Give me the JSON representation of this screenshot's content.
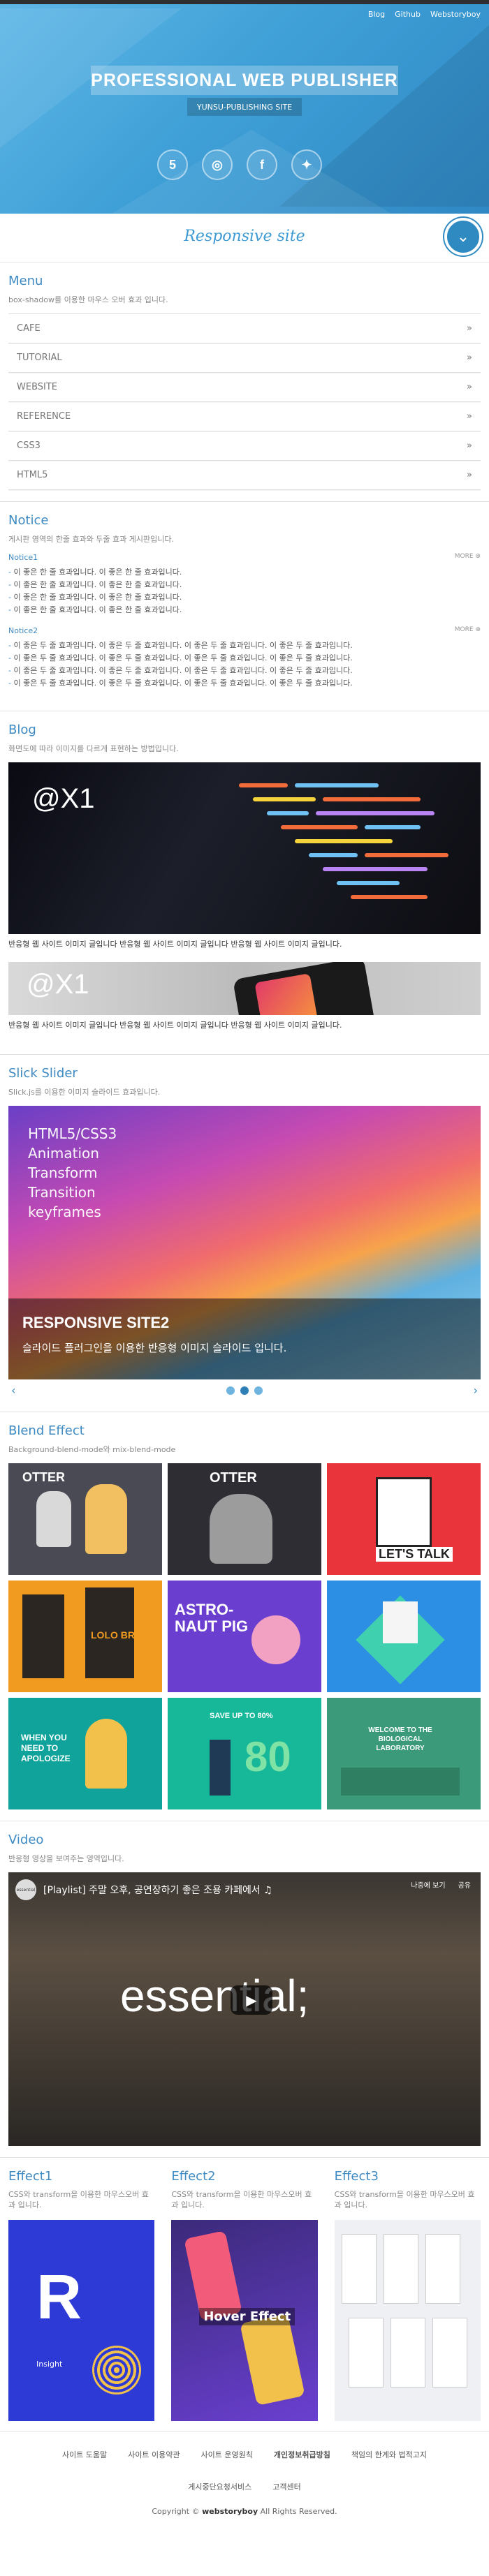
{
  "header": {
    "links": [
      "Blog",
      "Github",
      "Webstoryboy"
    ],
    "title": "PROFESSIONAL WEB PUBLISHER",
    "subtitle": "YUNSU-PUBLISHING SITE",
    "social": [
      {
        "icon": "html5-icon",
        "glyph": "5"
      },
      {
        "icon": "github-icon",
        "glyph": "◎"
      },
      {
        "icon": "facebook-icon",
        "glyph": "f"
      },
      {
        "icon": "twitter-icon",
        "glyph": "✦"
      }
    ]
  },
  "ribbon": {
    "tagline": "Responsive site",
    "down_glyph": "⌄"
  },
  "menu": {
    "title": "Menu",
    "desc": "box-shadow를 이용한 마우스 오버 효과 입니다.",
    "items": [
      "CAFE",
      "TUTORIAL",
      "WEBSITE",
      "REFERENCE",
      "CSS3",
      "HTML5"
    ],
    "chevron": "»"
  },
  "notice": {
    "title": "Notice",
    "desc": "게시판 영역의 한줄 효과와 두줄 효과 게시판입니다.",
    "groups": [
      {
        "label": "Notice1",
        "more": "MORE ⊕",
        "items": [
          "이 좋은 한 줄 효과입니다. 이 좋은 한 줄 효과입니다.",
          "이 좋은 한 줄 효과입니다. 이 좋은 한 줄 효과입니다.",
          "이 좋은 한 줄 효과입니다. 이 좋은 한 줄 효과입니다.",
          "이 좋은 한 줄 효과입니다. 이 좋은 한 줄 효과입니다."
        ]
      },
      {
        "label": "Notice2",
        "more": "MORE ⊕",
        "items": [
          "이 좋은 두 줄 효과입니다. 이 좋은 두 줄 효과입니다. 이 좋은 두 줄 효과입니다. 이 좋은 두 줄 효과입니다.",
          "이 좋은 두 줄 효과입니다. 이 좋은 두 줄 효과입니다. 이 좋은 두 줄 효과입니다. 이 좋은 두 줄 효과입니다.",
          "이 좋은 두 줄 효과입니다. 이 좋은 두 줄 효과입니다. 이 좋은 두 줄 효과입니다. 이 좋은 두 줄 효과입니다.",
          "이 좋은 두 줄 효과입니다. 이 좋은 두 줄 효과입니다. 이 좋은 두 줄 효과입니다. 이 좋은 두 줄 효과입니다."
        ]
      }
    ]
  },
  "blog": {
    "title": "Blog",
    "desc": "화면도에 따라 이미지를 다르게 표현하는 방법입니다.",
    "img_label": "@X1",
    "img2_label": "@X1",
    "captions": [
      "반응형 웹 사이트 이미지 글입니다 반응형 웹 사이트 이미지 글입니다 반응형 웹 사이트 이미지 글입니다.",
      "반응형 웹 사이트 이미지 글입니다 반응형 웹 사이트 이미지 글입니다 반응형 웹 사이트 이미지 글입니다."
    ]
  },
  "slider": {
    "title": "Slick Slider",
    "desc": "Slick.js를 이용한 이미지 슬라이드 효과입니다.",
    "overlay_lines": [
      "HTML5/CSS3",
      "Animation",
      "Transform",
      "Transition",
      "keyframes"
    ],
    "caption_title": "RESPONSIVE SITE2",
    "caption_text": "슬라이드 플러그인을 이용한 반응형 이미지 슬라이드 입니다.",
    "prev": "‹",
    "next": "›",
    "dots": 3,
    "active_dot": 1
  },
  "blend": {
    "title": "Blend Effect",
    "desc": "Background-blend-mode와 mix-blend-mode",
    "tiles": [
      {
        "label": "OTTER",
        "bg": "#4a4a55"
      },
      {
        "label": "OTTER",
        "bg": "#2d2d33"
      },
      {
        "label": "LET'S TALK",
        "bg": "#e8343a"
      },
      {
        "label": "LOLO BREW",
        "bg": "#f29b21"
      },
      {
        "label": "ASTRO-NAUT PIG",
        "bg": "#6a3fd0"
      },
      {
        "label": "",
        "bg": "#2d8fe4"
      },
      {
        "label": "WHEN YOU NEED TO APOLOGIZE",
        "bg": "#0fa39b"
      },
      {
        "label": "SAVE UP TO 80%",
        "bg": "#17b79a"
      },
      {
        "label": "WELCOME TO THE BIOLOGICAL LABORATORY",
        "bg": "#3a9a7a"
      }
    ]
  },
  "video": {
    "title": "Video",
    "desc": "반응형 영상을 보여주는 영역입니다.",
    "video_title": "[Playlist] 주말 오후, 공연장하기 좋은 조용 카페에서 ♫",
    "channel": "essential",
    "big_text": "essential;",
    "watch_later": "나중에 보기",
    "share": "공유"
  },
  "effects": [
    {
      "title": "Effect1",
      "desc": "CSS와 transform을 이용한 마우스오버 효과 입니다.",
      "thumb_text": "Insight"
    },
    {
      "title": "Effect2",
      "desc": "CSS와 transform을 이용한 마우스오버 효과 입니다.",
      "thumb_text": "Hover Effect"
    },
    {
      "title": "Effect3",
      "desc": "CSS와 transform을 이용한 마우스오버 효과 입니다.",
      "thumb_text": ""
    }
  ],
  "footer": {
    "links": [
      {
        "label": "사이트 도움말",
        "bold": false
      },
      {
        "label": "사이트 이용약관",
        "bold": false
      },
      {
        "label": "사이트 운영원칙",
        "bold": false
      },
      {
        "label": "개인정보취급방침",
        "bold": true
      },
      {
        "label": "책임의 한계와 법적고지",
        "bold": false
      },
      {
        "label": "게시중단요청서비스",
        "bold": false
      },
      {
        "label": "고객센터",
        "bold": false
      }
    ],
    "copy_prefix": "Copyright ©",
    "copy_brand": "webstoryboy",
    "copy_suffix": "All Rights Reserved."
  },
  "colors": {
    "accent": "#3e8ac3",
    "header": "#3fa0d7"
  }
}
